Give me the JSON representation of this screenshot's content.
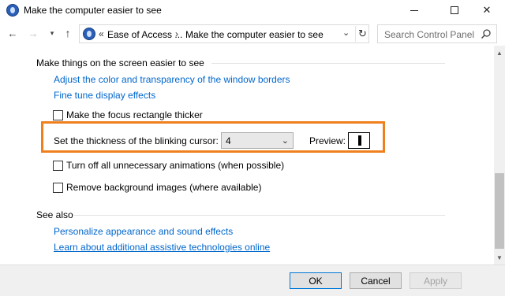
{
  "window": {
    "title": "Make the computer easier to see"
  },
  "nav": {
    "breadcrumb_prefix": "«",
    "crumbs": [
      "Ease of Access ...",
      "Make the computer easier to see"
    ],
    "crumb_separator": "›",
    "search_placeholder": "Search Control Panel"
  },
  "section1": {
    "heading": "Make things on the screen easier to see",
    "links": [
      "Adjust the color and transparency of the window borders",
      "Fine tune display effects"
    ],
    "focus_checkbox": {
      "label": "Make the focus rectangle thicker",
      "checked": false
    },
    "cursor": {
      "label": "Set the thickness of the blinking cursor:",
      "value": "4",
      "preview_label": "Preview:"
    },
    "animations_checkbox": {
      "label": "Turn off all unnecessary animations (when possible)",
      "checked": false
    },
    "background_checkbox": {
      "label": "Remove background images (where available)",
      "checked": false
    }
  },
  "see_also": {
    "heading": "See also",
    "links": [
      "Personalize appearance and sound effects",
      "Learn about additional assistive technologies online"
    ]
  },
  "footer": {
    "ok": "OK",
    "cancel": "Cancel",
    "apply": "Apply"
  },
  "colors": {
    "link": "#0066cc",
    "highlight": "#f07f1e"
  },
  "icons": [
    "app-icon",
    "back-arrow-icon",
    "forward-arrow-icon",
    "recent-locations-icon",
    "up-arrow-icon",
    "control-panel-icon",
    "chevron-down-icon",
    "refresh-icon",
    "search-icon"
  ]
}
